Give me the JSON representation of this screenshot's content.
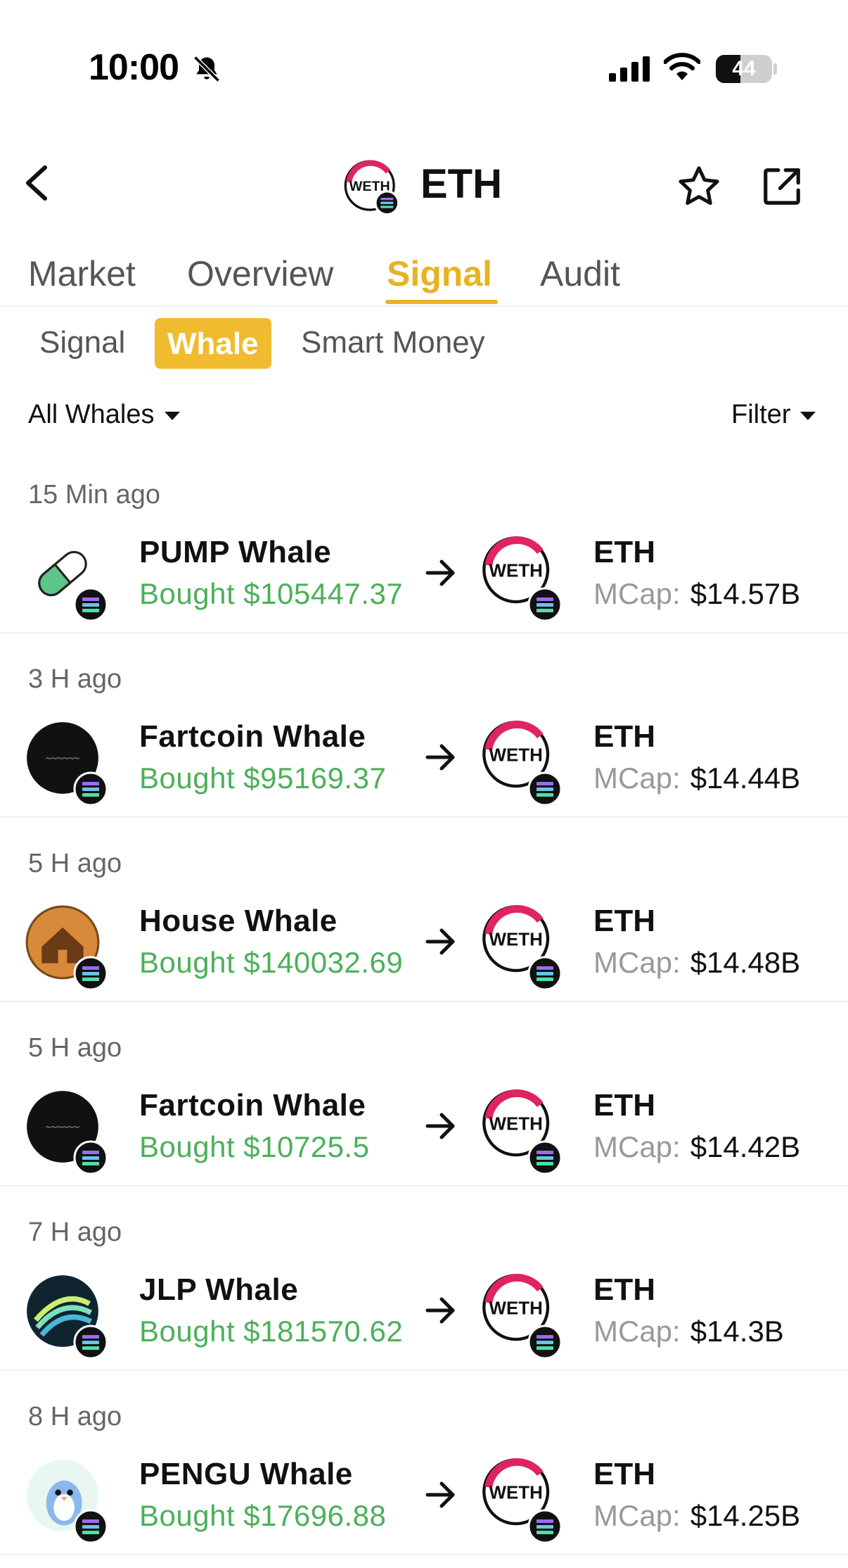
{
  "status_bar": {
    "time": "10:00",
    "battery_level": "44",
    "battery_fraction": 0.44,
    "icons": [
      "bell-slash-icon",
      "cellular-signal-icon",
      "wifi-icon",
      "battery-icon"
    ]
  },
  "header": {
    "title": "ETH",
    "token_logo_text": "WETH",
    "icons": [
      "back-icon",
      "star-icon",
      "share-icon"
    ]
  },
  "tabs": [
    {
      "label": "Market",
      "active": false
    },
    {
      "label": "Overview",
      "active": false
    },
    {
      "label": "Signal",
      "active": true
    },
    {
      "label": "Audit",
      "active": false
    }
  ],
  "subtabs": [
    {
      "label": "Signal",
      "active": false
    },
    {
      "label": "Whale",
      "active": true
    },
    {
      "label": "Smart Money",
      "active": false
    }
  ],
  "filters": {
    "whales_dropdown": "All Whales",
    "filter_dropdown": "Filter"
  },
  "feed": [
    {
      "time": "15 Min ago",
      "whale": "PUMP Whale",
      "amount": "Bought $105447.37",
      "token": "ETH",
      "mcap_label": "MCap:",
      "mcap_value": "$14.57B",
      "avatar": "pill-icon"
    },
    {
      "time": "3 H ago",
      "whale": "Fartcoin  Whale",
      "amount": "Bought $95169.37",
      "token": "ETH",
      "mcap_label": "MCap:",
      "mcap_value": "$14.44B",
      "avatar": "fartcoin-logo-icon"
    },
    {
      "time": "5 H ago",
      "whale": "House Whale",
      "amount": "Bought $140032.69",
      "token": "ETH",
      "mcap_label": "MCap:",
      "mcap_value": "$14.48B",
      "avatar": "house-coin-icon"
    },
    {
      "time": "5 H ago",
      "whale": "Fartcoin  Whale",
      "amount": "Bought $10725.5",
      "token": "ETH",
      "mcap_label": "MCap:",
      "mcap_value": "$14.42B",
      "avatar": "fartcoin-logo-icon"
    },
    {
      "time": "7 H ago",
      "whale": "JLP Whale",
      "amount": "Bought $181570.62",
      "token": "ETH",
      "mcap_label": "MCap:",
      "mcap_value": "$14.3B",
      "avatar": "jlp-logo-icon"
    },
    {
      "time": "8 H ago",
      "whale": "PENGU Whale",
      "amount": "Bought $17696.88",
      "token": "ETH",
      "mcap_label": "MCap:",
      "mcap_value": "$14.25B",
      "avatar": "penguin-icon"
    }
  ],
  "colors": {
    "accent": "#e8b320",
    "bought_green": "#4cb05a",
    "weth_red": "#e0245e"
  }
}
